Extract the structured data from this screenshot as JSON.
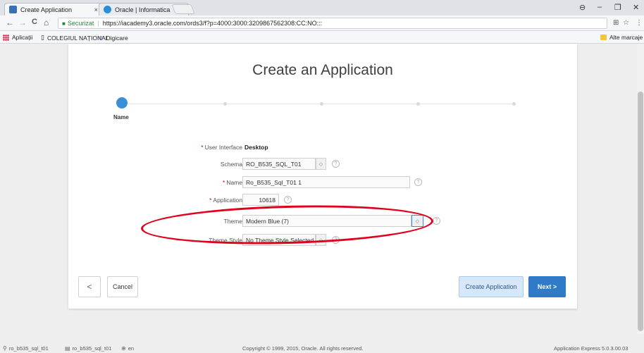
{
  "browser": {
    "tabs": [
      {
        "title": "Create Application",
        "active": true,
        "favicon_color": "#3b6fb6"
      },
      {
        "title": "Oracle | Informatica",
        "active": false,
        "favicon_color": "#2a8fd6"
      }
    ],
    "tab_close": "×",
    "window_controls": {
      "profile": "⊖",
      "minimize": "–",
      "maximize": "❐",
      "close": "✕"
    },
    "nav": {
      "back": "←",
      "forward": "→",
      "reload": "C",
      "home": "⌂"
    },
    "omnibox": {
      "secure_label": "Securizat",
      "url": "https://iacademy3.oracle.com/ords3/f?p=4000:3000:3209867562308:CC:NO:::"
    },
    "ext_icons": {
      "translate": "⊞",
      "star": "☆",
      "menu": "⋮"
    },
    "bookmarks": [
      {
        "label": "Aplicații",
        "icon": "apps-grid-icon"
      },
      {
        "label": "COLEGIUL NAȚIONAL",
        "icon": "page-icon"
      },
      {
        "label": "Digicare",
        "icon": "digicare-icon"
      }
    ],
    "other_bookmarks": "Alte marcaje"
  },
  "wizard": {
    "title": "Create an Application",
    "active_step_label": "Name",
    "step_count": 5,
    "fields": {
      "user_interface": {
        "label": "User Interface",
        "required": true,
        "value": "Desktop"
      },
      "schema": {
        "label": "Schema",
        "required": false,
        "value": "RO_B535_SQL_T01"
      },
      "name": {
        "label": "Name",
        "required": true,
        "value": "Ro_B535_Sql_T01 1"
      },
      "application": {
        "label": "Application",
        "required": true,
        "value": "10618"
      },
      "theme": {
        "label": "Theme",
        "required": false,
        "value": "Modern Blue (7)"
      },
      "theme_style": {
        "label": "Theme Style",
        "required": false,
        "value": "No Theme Style Selected"
      }
    },
    "help_glyph": "?",
    "required_mark": "*",
    "buttons": {
      "back": "<",
      "cancel": "Cancel",
      "create": "Create Application",
      "next": "Next >"
    }
  },
  "footer": {
    "user": "ro_b535_sql_t01",
    "workspace": "ro_b535_sql_t01",
    "language": "en",
    "copyright": "Copyright © 1999, 2015, Oracle. All rights reserved.",
    "version": "Application Express 5.0.3.00.03"
  },
  "colors": {
    "accent": "#2f7bc8",
    "annotation": "#e0001b",
    "secure": "#1a8a3a"
  }
}
